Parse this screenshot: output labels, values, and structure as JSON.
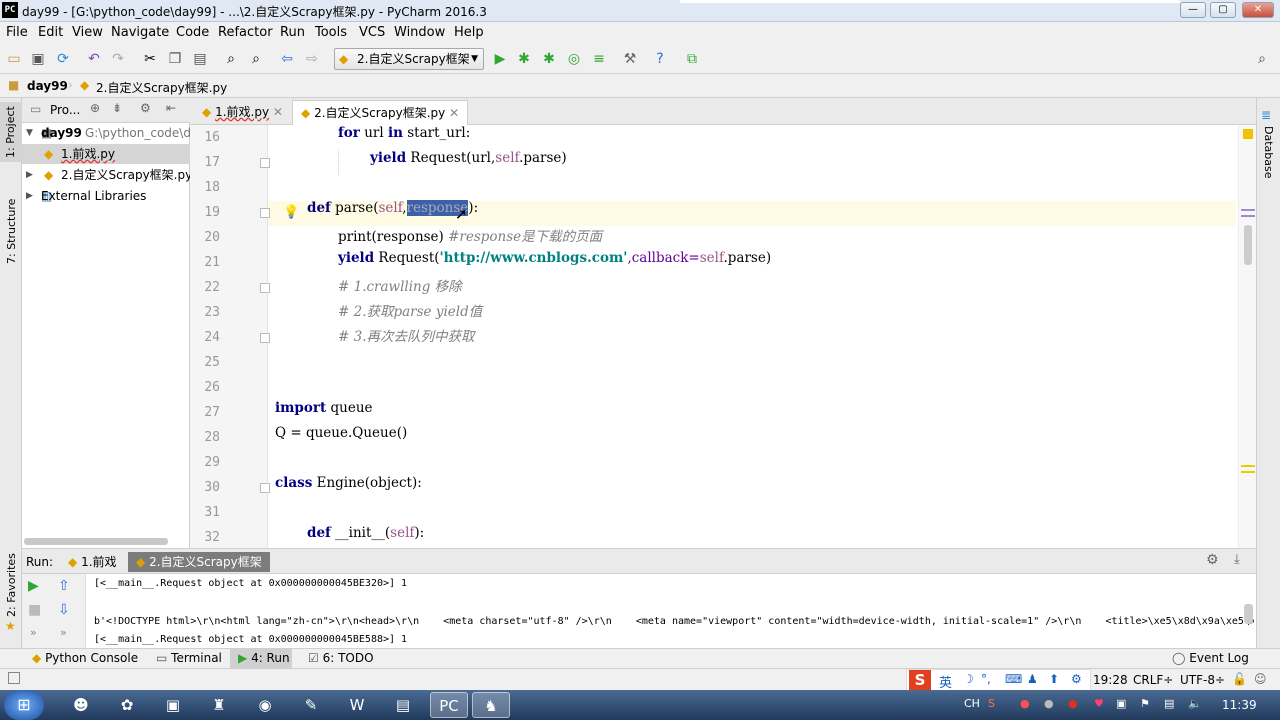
{
  "window": {
    "title": "day99 - [G:\\python_code\\day99] - ...\\2.自定义Scrapy框架.py - PyCharm 2016.3",
    "app_icon_label": "PC",
    "controls": {
      "minimize": "—",
      "maximize": "▢",
      "close": "✕"
    }
  },
  "menu": {
    "items": [
      "File",
      "Edit",
      "View",
      "Navigate",
      "Code",
      "Refactor",
      "Run",
      "Tools",
      "VCS",
      "Window",
      "Help"
    ]
  },
  "toolbar": {
    "run_config": "2.自定义Scrapy框架"
  },
  "navbar": {
    "crumbs": [
      "day99",
      "2.自定义Scrapy框架.py"
    ]
  },
  "left_strip": {
    "project": "1: Project",
    "structure": "7: Structure",
    "favorites": "2: Favorites"
  },
  "right_strip": {
    "database": "Database"
  },
  "project": {
    "header": "Pro...",
    "root": {
      "name": "day99",
      "path": "G:\\python_code\\d"
    },
    "files": [
      "1.前戏.py",
      "2.自定义Scrapy框架.py"
    ],
    "external": "External Libraries"
  },
  "editor": {
    "tabs": [
      {
        "label": "1.前戏.py",
        "active": false
      },
      {
        "label": "2.自定义Scrapy框架.py",
        "active": true
      }
    ],
    "line_numbers": [
      "16",
      "17",
      "18",
      "19",
      "20",
      "21",
      "22",
      "23",
      "24",
      "25",
      "26",
      "27",
      "28",
      "29",
      "30",
      "31",
      "32"
    ],
    "lines": {
      "l16": {
        "kw1": "for",
        "t1": " url ",
        "kw2": "in",
        "t2": " start_url:"
      },
      "l17": {
        "kw": "yield",
        "t": " Request(url,",
        "self": "self",
        "t2": ".parse)"
      },
      "l19": {
        "kw": "def",
        "t": " parse(",
        "self": "self",
        "t2": ",",
        "sel": "response",
        "t3": "):"
      },
      "l20": {
        "t": "print(response) ",
        "cm": "#response是下载的页面"
      },
      "l21": {
        "kw": "yield",
        "t": " Request(",
        "str": "'http://www.cnblogs.com'",
        "t2": ",callback=",
        "self": "self",
        "t3": ".parse)"
      },
      "l22": {
        "cm": "# 1.crawlling 移除"
      },
      "l23": {
        "cm": "# 2.获取parse yield值"
      },
      "l24": {
        "cm": "# 3.再次去队列中获取"
      },
      "l27": {
        "kw": "import",
        "t": " queue"
      },
      "l28": {
        "t": "Q = queue.Queue()"
      },
      "l30": {
        "kw": "class",
        "t": " Engine(object):"
      },
      "l32": {
        "kw": "def",
        "t": " __init__(",
        "self": "self",
        "t2": "):"
      }
    }
  },
  "run": {
    "label": "Run:",
    "tabs": [
      {
        "label": "1.前戏",
        "active": false
      },
      {
        "label": "2.自定义Scrapy框架",
        "active": true
      }
    ],
    "output": [
      "[<__main__.Request object at 0x000000000045BE320>] 1",
      "",
      "b'<!DOCTYPE html>\\r\\n<html lang=\"zh-cn\">\\r\\n<head>\\r\\n    <meta charset=\"utf-8\" />\\r\\n    <meta name=\"viewport\" content=\"width=device-width, initial-scale=1\" />\\r\\n    <title>\\xe5\\x8d\\x9a\\xe5\\xa",
      "[<__main__.Request object at 0x000000000045BE588>] 1"
    ]
  },
  "tool_windows": {
    "python_console": "Python Console",
    "terminal": "Terminal",
    "run": "4: Run",
    "todo": "6: TODO",
    "event_log": "Event Log"
  },
  "status": {
    "position": "19:28",
    "line_sep": "CRLF÷",
    "encoding": "UTF-8÷"
  },
  "taskbar": {
    "ime": "英",
    "lang": "CH",
    "clock": "11:39"
  }
}
